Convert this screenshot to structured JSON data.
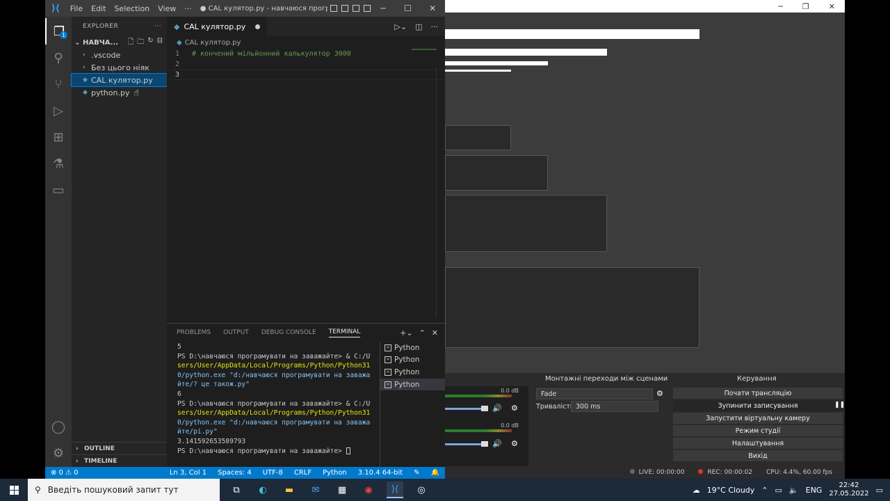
{
  "vscode": {
    "menu": [
      "File",
      "Edit",
      "Selection",
      "View",
      "···"
    ],
    "window_title": "● CAL кулятор.py - навчаюся програму...",
    "explorer_title": "EXPLORER",
    "explorer_more": "···",
    "folder_name": "НАВЧА...",
    "tree": [
      {
        "label": ".vscode",
        "type": "folder"
      },
      {
        "label": "Без цього ніяк",
        "type": "folder"
      },
      {
        "label": "CAL кулятор.py",
        "type": "python",
        "selected": true
      },
      {
        "label": "python.py",
        "type": "python",
        "selected": false
      }
    ],
    "outline_label": "OUTLINE",
    "timeline_label": "TIMELINE",
    "tab_label": "CAL кулятор.py",
    "breadcrumb_file": "CAL кулятор.py",
    "code": [
      {
        "n": "1",
        "text": "# кончений мільйонний калькулятор 3000"
      },
      {
        "n": "2",
        "text": ""
      },
      {
        "n": "3",
        "text": ""
      }
    ],
    "panel_tabs": [
      "PROBLEMS",
      "OUTPUT",
      "DEBUG CONSOLE",
      "TERMINAL"
    ],
    "terminal_lines": [
      "5",
      "PS D:\\навчаюся програмувати на заважайте> & C:/U",
      "sers/User/AppData/Local/Programs/Python/Python31",
      "0/python.exe \"d:/навчаюся програмувати на заважа",
      "йте/? це також.py\"",
      "6",
      "PS D:\\навчаюся програмувати на заважайте> & C:/U",
      "sers/User/AppData/Local/Programs/Python/Python31",
      "0/python.exe \"d:/навчаюся програмувати на заважа",
      "йте/pi.py\"",
      "3.141592653589793",
      "PS D:\\навчаюся програмувати на заважайте> "
    ],
    "terminal_instances": [
      "Python",
      "Python",
      "Python",
      "Python"
    ],
    "status": {
      "problems": "⊗ 0 ⚠ 0",
      "position": "Ln 3, Col 1",
      "spaces": "Spaces: 4",
      "encoding": "UTF-8",
      "eol": "CRLF",
      "language": "Python",
      "interpreter": "3.10.4 64-bit"
    }
  },
  "obs": {
    "transitions_title": "Монтажні переходи між сценами",
    "transition_value": "Fade",
    "duration_label": "Тривалість",
    "duration_value": "300 ms",
    "controls_title": "Керування",
    "controls": [
      "Почати трансляцію",
      "Зупинити записування",
      "Запустити віртуальну камеру",
      "Режим студії",
      "Налаштування",
      "Вихід"
    ],
    "meter_db": [
      "0.0 dB",
      "0.0 dB"
    ],
    "meter_ticks": [
      "-20",
      "-15",
      "-10",
      "-5",
      "0"
    ],
    "live": "LIVE: 00:00:00",
    "rec": "REC: 00:00:02",
    "cpu": "CPU: 4.4%, 60.00 fps"
  },
  "taskbar": {
    "search_placeholder": "Введіть пошуковий запит тут",
    "weather": "19°C  Cloudy",
    "lang": "ENG",
    "time": "22:42",
    "date": "27.05.2022"
  }
}
